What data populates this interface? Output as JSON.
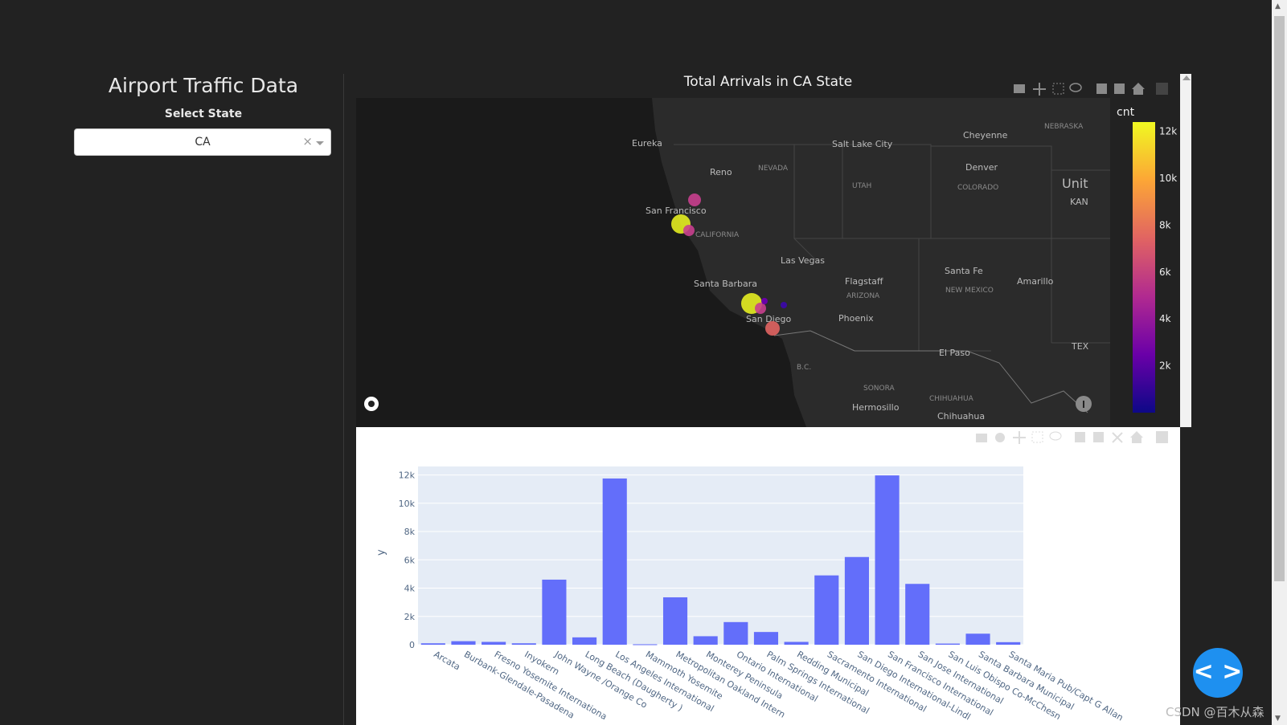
{
  "sidebar": {
    "title": "Airport Traffic Data",
    "select_label": "Select State",
    "selected_state": "CA",
    "clear_symbol": "×"
  },
  "map": {
    "title": "Total Arrivals in CA State",
    "colorbar_title": "cnt",
    "colorbar_ticks": [
      "12k",
      "10k",
      "8k",
      "6k",
      "4k",
      "2k"
    ],
    "colorscale": [
      "#0d0887",
      "#6a00a8",
      "#b12a90",
      "#e16462",
      "#fca636",
      "#f0f921"
    ],
    "place_labels": [
      "Eureka",
      "Reno",
      "NEVADA",
      "Salt Lake City",
      "UTAH",
      "Cheyenne",
      "NEBRASKA",
      "Denver",
      "COLORADO",
      "Unit",
      "KAN",
      "San Francisco",
      "CALIFORNIA",
      "Las Vegas",
      "Santa Fe",
      "NEW MEXICO",
      "Amarillo",
      "Santa Barbara",
      "Flagstaff",
      "ARIZONA",
      "Phoenix",
      "San Diego",
      "El Paso",
      "TEX",
      "B.C.",
      "SONORA",
      "CHIHUAHUA",
      "Hermosillo",
      "Chihuahua"
    ],
    "airports": [
      {
        "place": "San Francisco",
        "cnt": 11970
      },
      {
        "place": "Sacramento",
        "cnt": 4890
      },
      {
        "place": "Oakland",
        "cnt": 4300
      },
      {
        "place": "Los Angeles",
        "cnt": 11750
      },
      {
        "place": "Burbank",
        "cnt": 4580
      },
      {
        "place": "San Diego",
        "cnt": 6200
      },
      {
        "place": "Ontario",
        "cnt": 1600
      },
      {
        "place": "Palm Springs",
        "cnt": 600
      }
    ],
    "toolbar_icons": [
      "camera-icon",
      "pan-icon",
      "box-select-icon",
      "lasso-icon",
      "zoom-in-icon",
      "zoom-out-icon",
      "home-icon",
      "plotly-logo-icon"
    ]
  },
  "chart_data": {
    "type": "bar",
    "categories": [
      "Arcata",
      "Burbank-Glendale-Pasadena",
      "Fresno Yosemite International",
      "Inyokern",
      "John Wayne /Orange Co",
      "Long Beach (Daugherty )",
      "Los Angeles International",
      "Mammoth Yosemite",
      "Metropolitan Oakland International",
      "Monterey Peninsula",
      "Ontario International",
      "Palm Springs International",
      "Redding Municipal",
      "Sacramento International",
      "San Diego International-Lindbergh",
      "San Francisco International",
      "San Jose International",
      "San Luis Obispo Co-McChesney",
      "Santa Barbara Municipal",
      "Santa Maria Pub/Capt G Allan Hancock"
    ],
    "display_categories": [
      "Arcata",
      "Burbank-Glendale-Pasadena",
      "Fresno Yosemite Internationa",
      "Inyokern",
      "John Wayne /Orange Co",
      "Long Beach (Daugherty )",
      "Los Angeles International",
      "Mammoth Yosemite",
      "Metropolitan Oakland Intern",
      "Monterey Peninsula",
      "Ontario International",
      "Palm Springs International",
      "Redding Municipal",
      "Sacramento International",
      "San Diego International-Lindl",
      "San Francisco International",
      "San Jose International",
      "San Luis Obispo Co-McChesn",
      "Santa Barbara Municipal",
      "Santa Maria Pub/Capt G Allan"
    ],
    "values": [
      100,
      250,
      200,
      100,
      4600,
      520,
      11750,
      30,
      3350,
      600,
      1600,
      900,
      200,
      4900,
      6200,
      11970,
      4300,
      80,
      780,
      180
    ],
    "ylabel": "y",
    "xlabel": "",
    "ylim": [
      0,
      12600
    ],
    "yticks": [
      0,
      2000,
      4000,
      6000,
      8000,
      10000,
      12000
    ],
    "ytick_labels": [
      "0",
      "2k",
      "4k",
      "6k",
      "8k",
      "10k",
      "12k"
    ],
    "bar_color": "#636efa",
    "plot_bg": "#e5ecf6",
    "grid": true
  },
  "fab": {
    "symbol": "< >"
  },
  "watermark": "CSDN @百木从森"
}
